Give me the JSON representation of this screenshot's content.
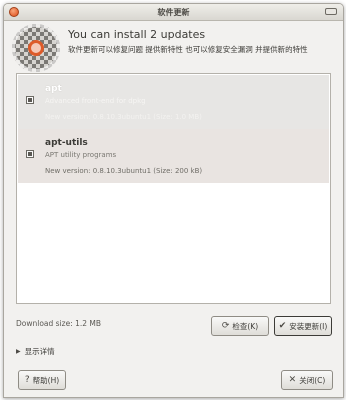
{
  "window": {
    "title": "软件更新"
  },
  "header": {
    "heading": "You can install 2 updates",
    "subheading": "软件更新可以修复问题 提供新特性 也可以修复安全漏洞 并提供新的特性"
  },
  "updates": [
    {
      "name": "apt",
      "description": "Advanced front-end for dpkg",
      "version": "New version: 0.8.10.3ubuntu1 (Size: 1.0 MB)",
      "checked": true
    },
    {
      "name": "apt-utils",
      "description": "APT utility programs",
      "version": "New version: 0.8.10.3ubuntu1 (Size: 200 kB)",
      "checked": true
    }
  ],
  "footer": {
    "download_size": "Download size: 1.2 MB",
    "check_label": "检查(K)",
    "install_label": "安装更新(I)",
    "details_label": "显示详情",
    "help_label": "帮助(H)",
    "close_label": "关闭(C)"
  },
  "icons": {
    "close": "close-icon",
    "maximize": "maximize-icon",
    "update_manager": "update-manager-icon",
    "check": "refresh-icon",
    "install": "install-icon",
    "expander": "triangle-right-icon",
    "help": "help-icon",
    "close_button": "close-x-icon"
  },
  "colors": {
    "accent": "#dd5b2a",
    "background": "#f2f1ef"
  }
}
